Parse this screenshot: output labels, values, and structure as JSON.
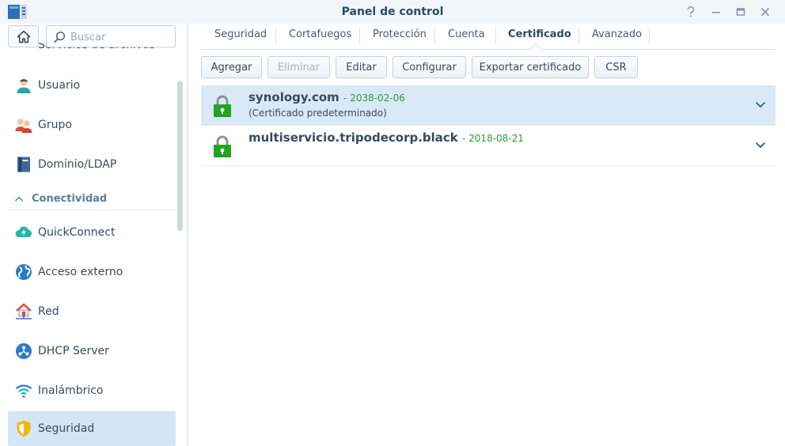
{
  "window": {
    "title": "Panel de control",
    "icons": [
      "app-icon",
      "help-icon",
      "minimize-icon",
      "maximize-icon",
      "close-icon"
    ]
  },
  "search": {
    "placeholder": "Buscar"
  },
  "sidebar": {
    "partial_item": "Servicios de archivos",
    "items": [
      {
        "label": "Usuario",
        "icon": "user-icon"
      },
      {
        "label": "Grupo",
        "icon": "group-icon"
      },
      {
        "label": "Dominio/LDAP",
        "icon": "domain-icon"
      }
    ],
    "section": {
      "label": "Conectividad"
    },
    "section_items": [
      {
        "label": "QuickConnect",
        "icon": "quickconnect-icon"
      },
      {
        "label": "Acceso externo",
        "icon": "external-access-icon"
      },
      {
        "label": "Red",
        "icon": "network-icon"
      },
      {
        "label": "DHCP Server",
        "icon": "dhcp-icon"
      },
      {
        "label": "Inalámbrico",
        "icon": "wireless-icon"
      },
      {
        "label": "Seguridad",
        "icon": "security-icon",
        "active": true
      }
    ]
  },
  "tabs": [
    {
      "label": "Seguridad"
    },
    {
      "label": "Cortafuegos"
    },
    {
      "label": "Protección"
    },
    {
      "label": "Cuenta"
    },
    {
      "label": "Certificado",
      "active": true
    },
    {
      "label": "Avanzado"
    }
  ],
  "toolbar": {
    "add": "Agregar",
    "delete": "Eliminar",
    "edit": "Editar",
    "configure": "Configurar",
    "export": "Exportar certificado",
    "csr": "CSR"
  },
  "certificates": [
    {
      "name": "synology.com",
      "date": "- 2038-02-06",
      "note": "(Certificado predeterminado)",
      "selected": true
    },
    {
      "name": "multiservicio.tripodecorp.black",
      "date": "- 2018-08-21",
      "note": "",
      "selected": false
    }
  ],
  "colors": {
    "accent": "#2c4a66",
    "selected_row": "#d9e9f7",
    "date_green": "#2e9a3a",
    "lock_green": "#1fa51f"
  }
}
